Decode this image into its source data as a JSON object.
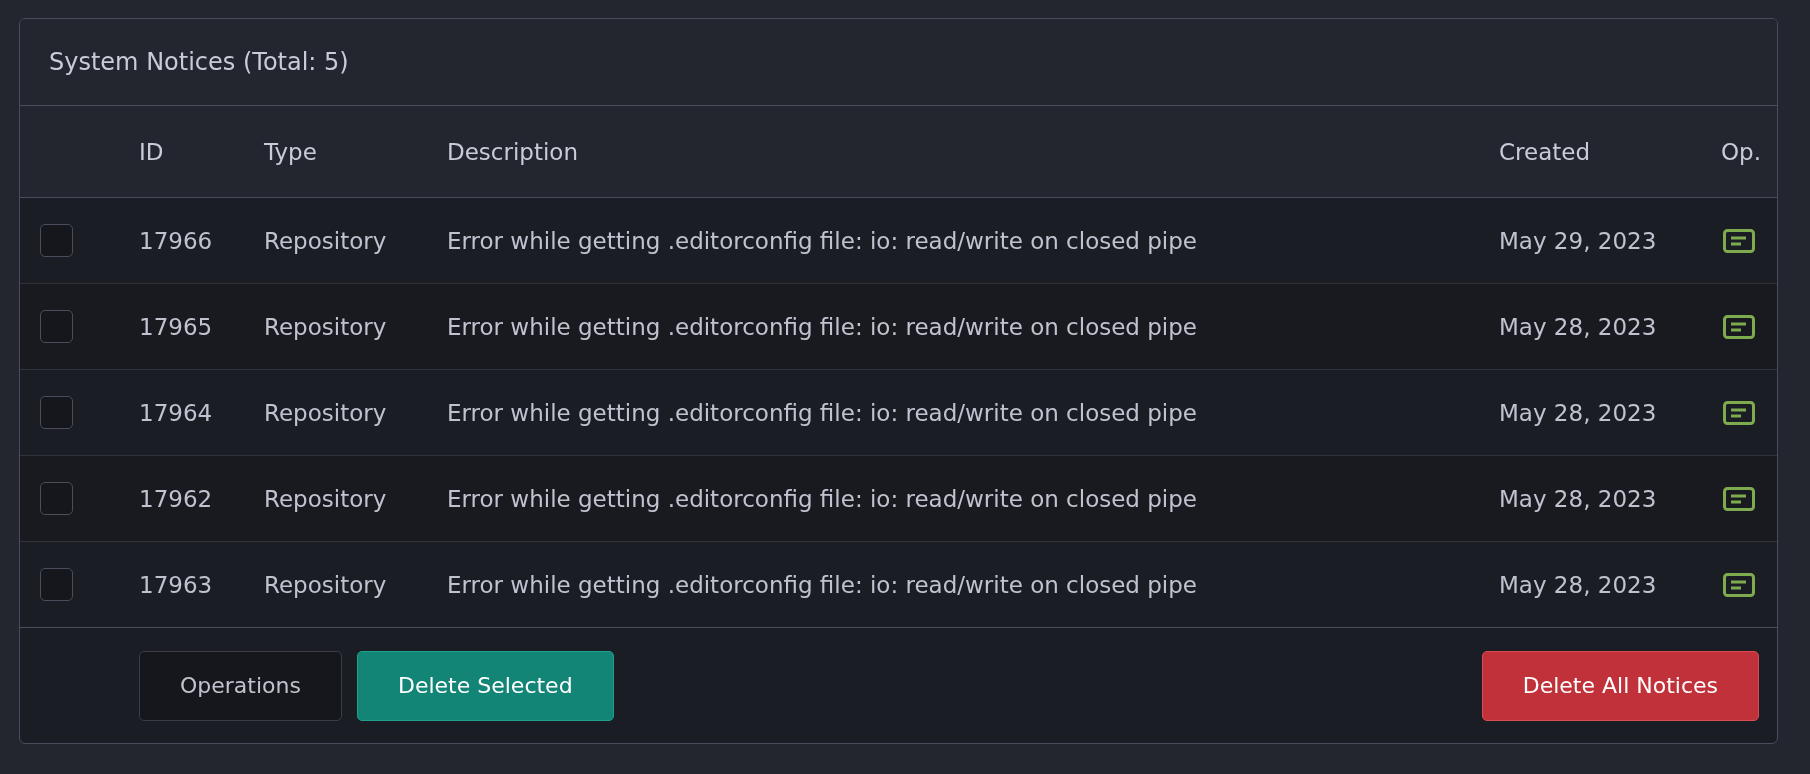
{
  "panel": {
    "title": "System Notices (Total: 5)"
  },
  "table": {
    "columns": [
      "ID",
      "Type",
      "Description",
      "Created",
      "Op."
    ],
    "rows": [
      {
        "checked": false,
        "id": "17966",
        "type": "Repository",
        "description": "Error while getting .editorconfig file: io: read/write on closed pipe",
        "created": "May 29, 2023"
      },
      {
        "checked": false,
        "id": "17965",
        "type": "Repository",
        "description": "Error while getting .editorconfig file: io: read/write on closed pipe",
        "created": "May 28, 2023"
      },
      {
        "checked": false,
        "id": "17964",
        "type": "Repository",
        "description": "Error while getting .editorconfig file: io: read/write on closed pipe",
        "created": "May 28, 2023"
      },
      {
        "checked": false,
        "id": "17962",
        "type": "Repository",
        "description": "Error while getting .editorconfig file: io: read/write on closed pipe",
        "created": "May 28, 2023"
      },
      {
        "checked": false,
        "id": "17963",
        "type": "Repository",
        "description": "Error while getting .editorconfig file: io: read/write on closed pipe",
        "created": "May 28, 2023"
      }
    ]
  },
  "footer": {
    "buttons": [
      {
        "label": "Operations",
        "kind": "plain"
      },
      {
        "label": "Delete Selected",
        "kind": "primary"
      },
      {
        "label": "Delete All Notices",
        "kind": "danger"
      }
    ]
  }
}
